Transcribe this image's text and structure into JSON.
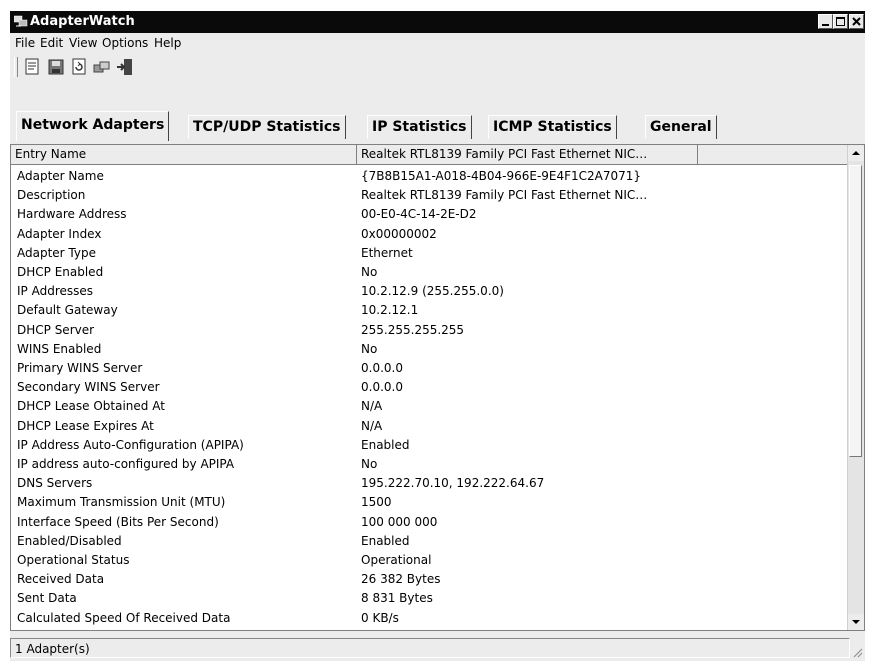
{
  "window": {
    "title": "AdapterWatch"
  },
  "menu": [
    "File",
    "Edit",
    "View",
    "Options",
    "Help"
  ],
  "toolbar": {
    "icons": [
      "properties-icon",
      "save-icon",
      "refresh-icon",
      "copy-icon",
      "exit-icon"
    ]
  },
  "tabs": [
    "Network Adapters",
    "TCP/UDP Statistics",
    "IP Statistics",
    "ICMP Statistics",
    "General"
  ],
  "table": {
    "headers": [
      "Entry Name",
      "Realtek RTL8139 Family PCI Fast Ethernet NIC…",
      ""
    ],
    "rows": [
      {
        "name": "Adapter Name",
        "value": "{7B8B15A1-A018-4B04-966E-9E4F1C2A7071}"
      },
      {
        "name": "Description",
        "value": "Realtek RTL8139 Family PCI Fast Ethernet NIC…"
      },
      {
        "name": "Hardware Address",
        "value": "00-E0-4C-14-2E-D2"
      },
      {
        "name": "Adapter Index",
        "value": "0x00000002"
      },
      {
        "name": "Adapter Type",
        "value": "Ethernet"
      },
      {
        "name": "DHCP Enabled",
        "value": "No"
      },
      {
        "name": "IP Addresses",
        "value": "10.2.12.9 (255.255.0.0)"
      },
      {
        "name": "Default Gateway",
        "value": "10.2.12.1"
      },
      {
        "name": "DHCP Server",
        "value": "255.255.255.255"
      },
      {
        "name": "WINS Enabled",
        "value": "No"
      },
      {
        "name": "Primary WINS Server",
        "value": "0.0.0.0"
      },
      {
        "name": "Secondary  WINS Server",
        "value": "0.0.0.0"
      },
      {
        "name": "DHCP Lease Obtained At",
        "value": "N/A"
      },
      {
        "name": "DHCP Lease Expires At",
        "value": "N/A"
      },
      {
        "name": "IP Address Auto-Configuration (APIPA)",
        "value": "Enabled"
      },
      {
        "name": "IP address auto-configured by APIPA",
        "value": "No"
      },
      {
        "name": "DNS Servers",
        "value": "195.222.70.10, 192.222.64.67"
      },
      {
        "name": "Maximum Transmission Unit (MTU)",
        "value": "1500"
      },
      {
        "name": "Interface Speed (Bits Per Second)",
        "value": "100 000 000"
      },
      {
        "name": "Enabled/Disabled",
        "value": "Enabled"
      },
      {
        "name": "Operational Status",
        "value": "Operational"
      },
      {
        "name": "Received Data",
        "value": "26 382 Bytes"
      },
      {
        "name": "Sent Data",
        "value": "8 831 Bytes"
      },
      {
        "name": "Calculated Speed Of Received Data",
        "value": "0 KB/s"
      }
    ]
  },
  "status": {
    "text": "1 Adapter(s)"
  }
}
